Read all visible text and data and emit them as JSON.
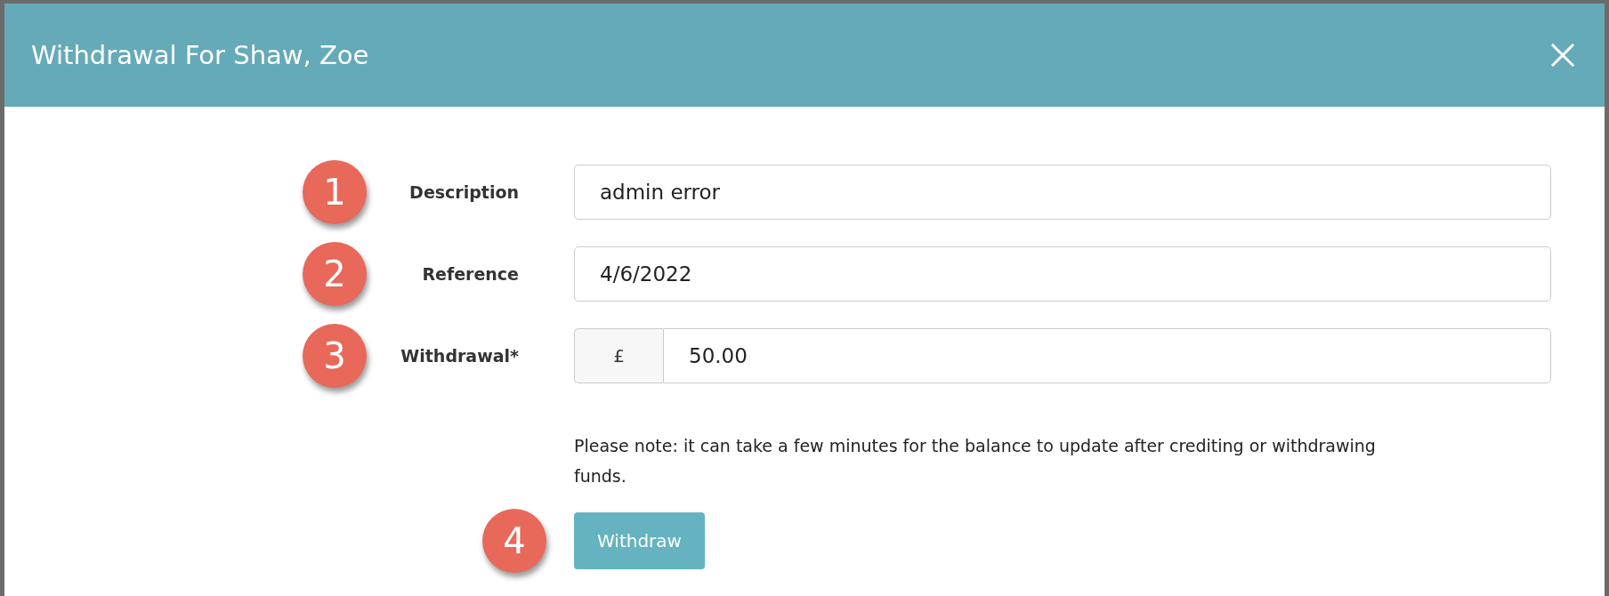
{
  "dialog": {
    "title": "Withdrawal For Shaw, Zoe"
  },
  "fields": [
    {
      "marker": "1",
      "label": "Description",
      "kind": "text",
      "value": "admin error"
    },
    {
      "marker": "2",
      "label": "Reference",
      "kind": "text",
      "value": "4/6/2022"
    },
    {
      "marker": "3",
      "label": "Withdrawal*",
      "kind": "currency",
      "prefix": "£",
      "value": "50.00"
    }
  ],
  "note": "Please note: it can take a few minutes for the balance to update after crediting or withdrawing funds.",
  "submit": {
    "marker": "4",
    "label": "Withdraw"
  }
}
